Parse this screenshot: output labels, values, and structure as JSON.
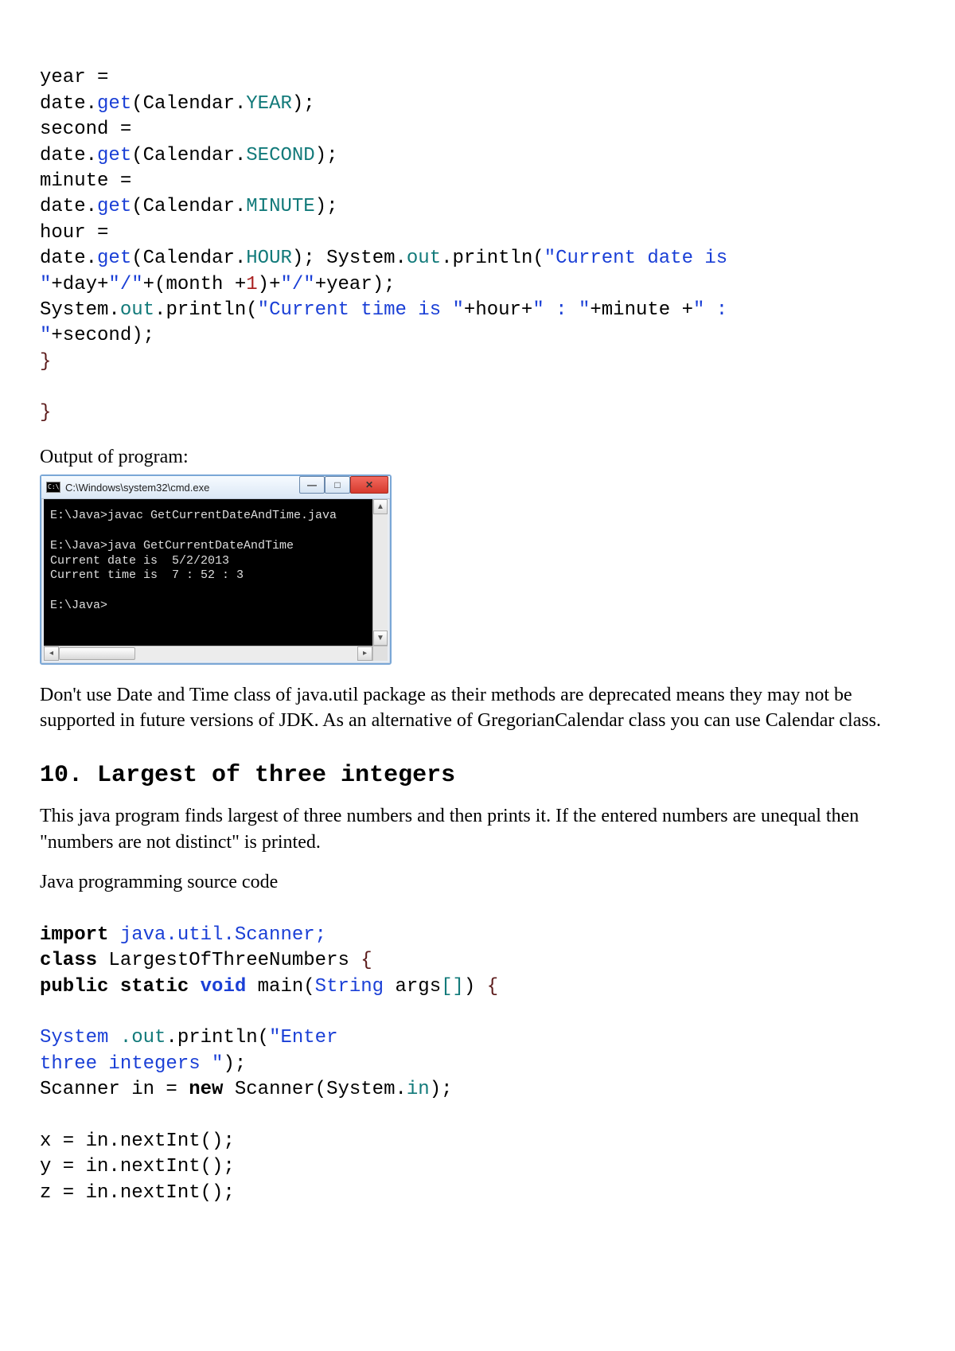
{
  "code1": {
    "l1a": "year =",
    "l2_pre": "date.",
    "l2_get": "get",
    "l2_par": "(Calendar.",
    "l2_f": "YEAR",
    "l2_end": ");",
    "l3a": "second =",
    "l4_pre": "date.",
    "l4_get": "get",
    "l4_par": "(Calendar.",
    "l4_f": "SECOND",
    "l4_end": ");",
    "l5a": "minute =",
    "l6_pre": "date.",
    "l6_get": "get",
    "l6_par": "(Calendar.",
    "l6_f": "MINUTE",
    "l6_end": ");",
    "l7a": "hour =",
    "l8_pre": "date.",
    "l8_get": "get",
    "l8_par": "(Calendar.",
    "l8_f": "HOUR",
    "l8_end": "); System.",
    "l8_out": "out",
    "l8_println": ".println(",
    "l8_s1": "\"Current date is",
    "l9_s1": "\"",
    "l9_plus1": "+day+",
    "l9_s2": "\"/\"",
    "l9_plus2": "+(month +",
    "l9_one": "1",
    "l9_plus3": ")+",
    "l9_s3": "\"/\"",
    "l9_plus4": "+year);",
    "l10_pre": "System.",
    "l10_out": "out",
    "l10_println": ".println(",
    "l10_s1": "\"Current time is \"",
    "l10_plus1": "+hour+",
    "l10_s2": "\" : \"",
    "l10_plus2": "+minute +",
    "l10_s3": "\" :",
    "l11_s1": "\"",
    "l11_plus": "+second);",
    "l12": "}",
    "l13": "}"
  },
  "output_label": "Output of program:",
  "cmd": {
    "title": "C:\\Windows\\system32\\cmd.exe",
    "body": "E:\\Java>javac GetCurrentDateAndTime.java\n\nE:\\Java>java GetCurrentDateAndTime\nCurrent date is  5/2/2013\nCurrent time is  7 : 52 : 3\n\nE:\\Java>"
  },
  "para1": "Don't use Date and Time class of java.util package as their methods are deprecated means they may not be supported in future versions of JDK. As an alternative of GregorianCalendar class you can use Calendar class.",
  "heading": "10. Largest of three integers",
  "para2": "This java program finds largest of three numbers and then prints it. If the entered numbers are unequal then \"numbers are not distinct\" is printed.",
  "para3": "Java programming source code",
  "code2": {
    "l1_imp": "import",
    "l1_pkg": " java.util.Scanner;",
    "l2_cls": "class",
    "l2_name": " LargestOfThreeNumbers ",
    "l2_brace": "{",
    "l3_mod": "public static ",
    "l3_void": "void",
    "l3_main": " main(",
    "l3_str": "String",
    "l3_args": " args",
    "l3_brk": "[]",
    "l3_end": ") ",
    "l3_brace": "{",
    "l4_sys": "System ",
    "l4_out": ".out",
    "l4_pr": ".println(",
    "l4_s1": "\"Enter",
    "l5_s1": "three integers \"",
    "l5_end": ");",
    "l6_a": "Scanner in = ",
    "l6_new": "new",
    "l6_b": " Scanner(System.",
    "l6_in": "in",
    "l6_c": ");",
    "l7": "x = in.nextInt();",
    "l8": "y = in.nextInt();",
    "l9": "z = in.nextInt();"
  }
}
